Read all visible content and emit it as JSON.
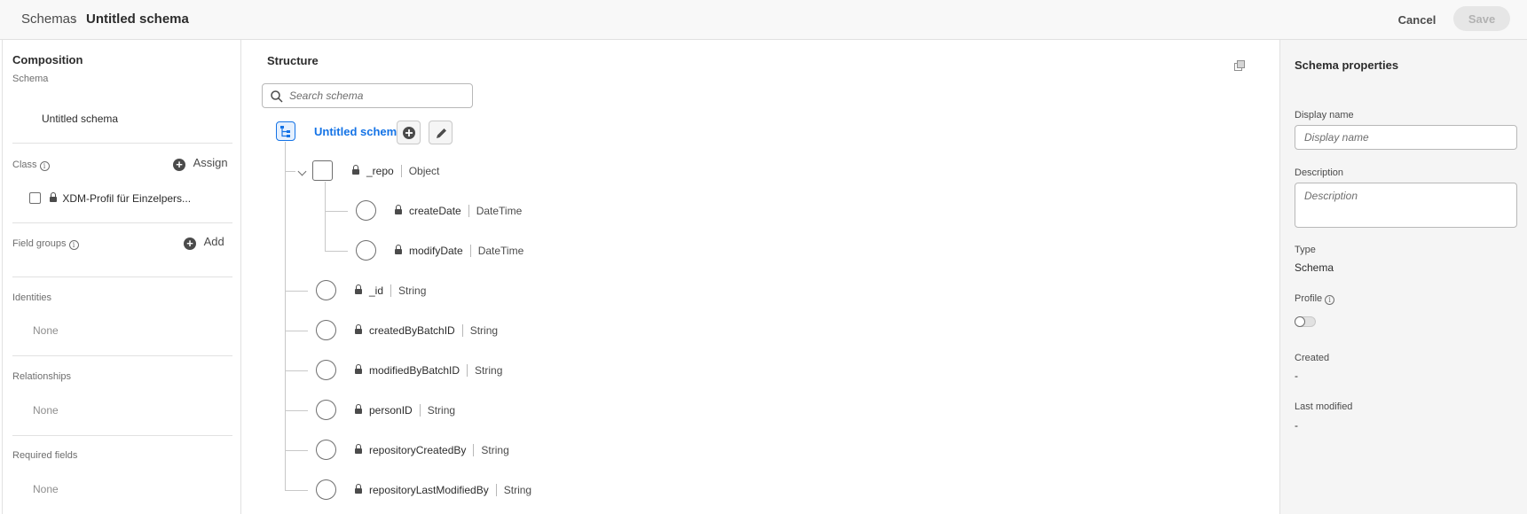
{
  "header": {
    "breadcrumb_root": "Schemas",
    "breadcrumb_separator": "›",
    "breadcrumb_current": "Untitled schema",
    "cancel_label": "Cancel",
    "save_label": "Save"
  },
  "composition": {
    "title": "Composition",
    "schema_label": "Schema",
    "schema_name": "Untitled schema",
    "class_label": "Class",
    "class_action": "Assign",
    "class_item": "XDM-Profil für Einzelpers...",
    "field_groups_label": "Field groups",
    "field_groups_action": "Add",
    "identities_label": "Identities",
    "identities_value": "None",
    "relationships_label": "Relationships",
    "relationships_value": "None",
    "required_fields_label": "Required fields",
    "required_fields_value": "None"
  },
  "structure": {
    "title": "Structure",
    "search_placeholder": "Search schema",
    "root_name": "Untitled schema",
    "fields": [
      {
        "name": "_repo",
        "type": "Object",
        "locked": true,
        "level": 1,
        "kind": "object"
      },
      {
        "name": "createDate",
        "type": "DateTime",
        "locked": true,
        "level": 2,
        "kind": "field"
      },
      {
        "name": "modifyDate",
        "type": "DateTime",
        "locked": true,
        "level": 2,
        "kind": "field"
      },
      {
        "name": "_id",
        "type": "String",
        "locked": true,
        "level": 1,
        "kind": "field"
      },
      {
        "name": "createdByBatchID",
        "type": "String",
        "locked": true,
        "level": 1,
        "kind": "field"
      },
      {
        "name": "modifiedByBatchID",
        "type": "String",
        "locked": true,
        "level": 1,
        "kind": "field"
      },
      {
        "name": "personID",
        "type": "String",
        "locked": true,
        "level": 1,
        "kind": "field"
      },
      {
        "name": "repositoryCreatedBy",
        "type": "String",
        "locked": true,
        "level": 1,
        "kind": "field"
      },
      {
        "name": "repositoryLastModifiedBy",
        "type": "String",
        "locked": true,
        "level": 1,
        "kind": "field"
      }
    ]
  },
  "properties": {
    "title": "Schema properties",
    "display_name_label": "Display name",
    "display_name_placeholder": "Display name",
    "description_label": "Description",
    "description_placeholder": "Description",
    "type_label": "Type",
    "type_value": "Schema",
    "profile_label": "Profile",
    "profile_enabled": false,
    "created_label": "Created",
    "created_value": "-",
    "last_modified_label": "Last modified",
    "last_modified_value": "-"
  },
  "colors": {
    "accent": "#1473e6",
    "right_panel_bg": "#f5f5f5",
    "header_bg": "#f8f8f8"
  }
}
